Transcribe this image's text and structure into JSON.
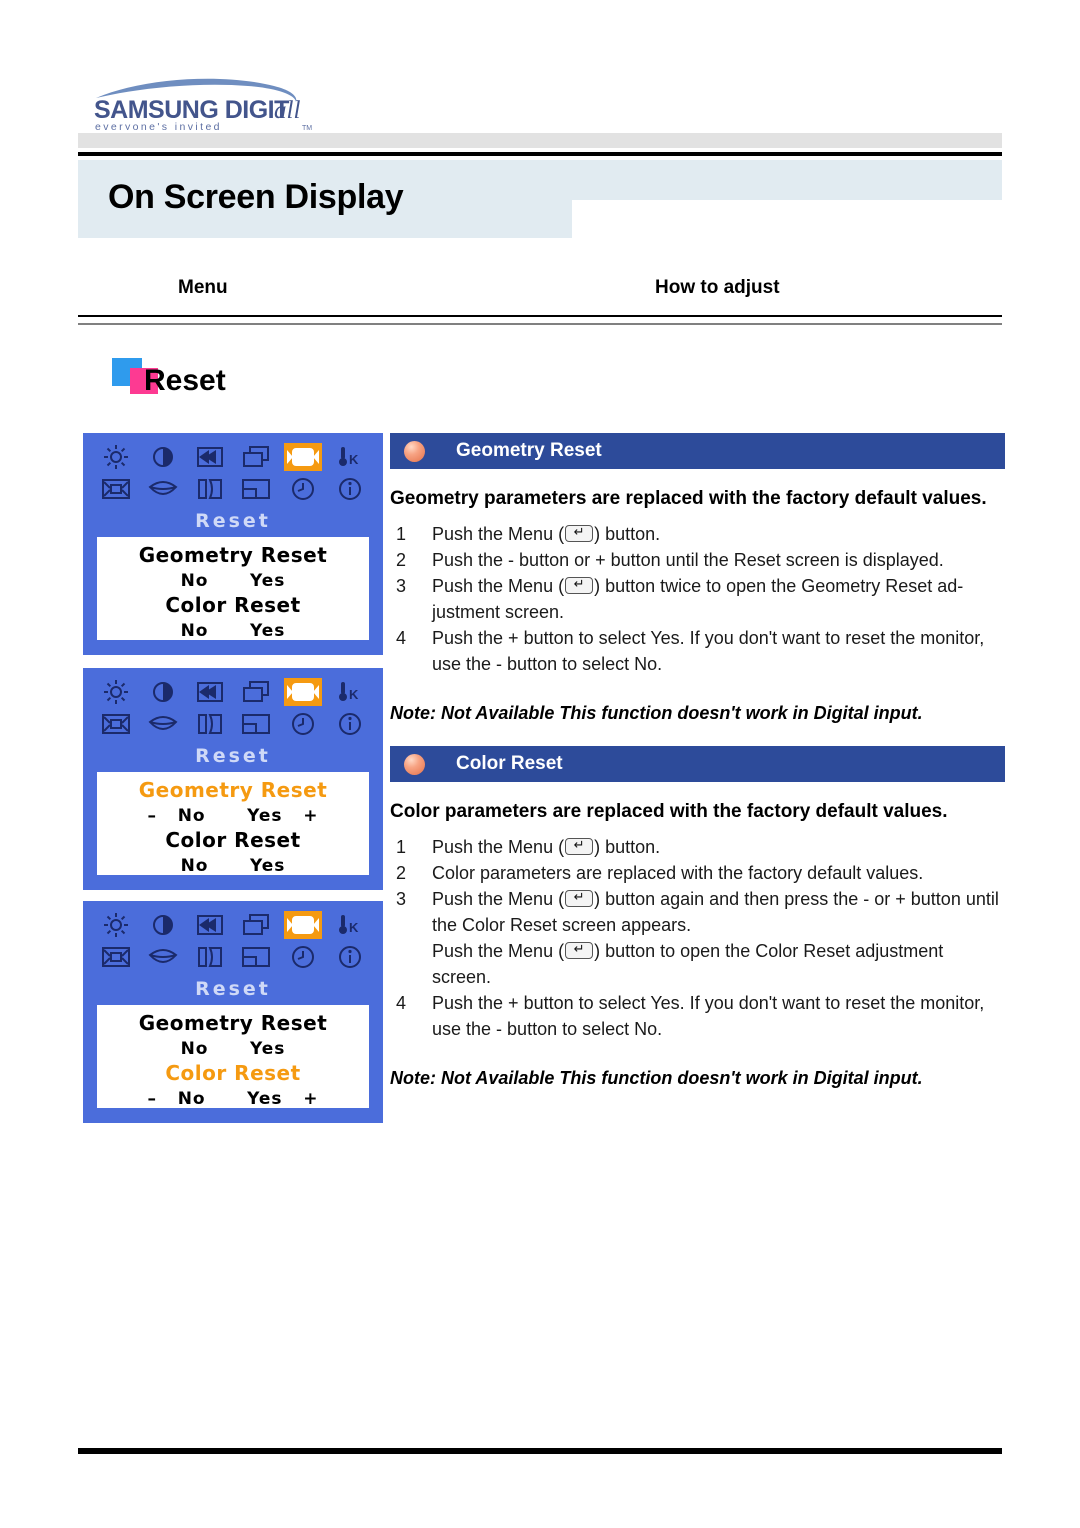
{
  "brand": {
    "wordmark_main": "SAMSUNG DIGIT",
    "wordmark_italic": "all",
    "tagline": "e v e r y o n e ' s   i n v i t e d",
    "tagline_tm": "TM"
  },
  "header": {
    "page_title": "On Screen Display",
    "column_menu": "Menu",
    "column_how": "How to adjust"
  },
  "section": {
    "title": "Reset",
    "square_blue": "#2f9bed",
    "square_pink": "#fd3a92"
  },
  "osd": {
    "background": "#4b6ddb",
    "highlight": "#f59a11",
    "label": "Reset",
    "icons": [
      {
        "name": "brightness-icon",
        "row": 1
      },
      {
        "name": "contrast-icon",
        "row": 1
      },
      {
        "name": "image-position-icon",
        "row": 1
      },
      {
        "name": "image-size-icon",
        "row": 1
      },
      {
        "name": "reset-icon",
        "row": 1,
        "selected": true
      },
      {
        "name": "color-temperature-icon",
        "row": 1
      },
      {
        "name": "zoom-icon",
        "row": 2
      },
      {
        "name": "smile-icon",
        "row": 2
      },
      {
        "name": "pincushion-icon",
        "row": 2
      },
      {
        "name": "osd-position-icon",
        "row": 2
      },
      {
        "name": "clock-icon",
        "row": 2
      },
      {
        "name": "information-icon",
        "row": 2
      }
    ],
    "panels": [
      {
        "name": "osd-panel-1",
        "rows": [
          {
            "text": "Geometry Reset",
            "highlight": false,
            "type": "title"
          },
          {
            "text": "No      Yes",
            "highlight": false,
            "type": "options"
          },
          {
            "text": "Color Reset",
            "highlight": false,
            "type": "title"
          },
          {
            "text": "No      Yes",
            "highlight": false,
            "type": "options"
          }
        ]
      },
      {
        "name": "osd-panel-2",
        "rows": [
          {
            "text": "Geometry Reset",
            "highlight": true,
            "type": "title"
          },
          {
            "text": "–   No      Yes   +",
            "highlight": false,
            "type": "options"
          },
          {
            "text": "Color Reset",
            "highlight": false,
            "type": "title"
          },
          {
            "text": "No      Yes",
            "highlight": false,
            "type": "options"
          }
        ]
      },
      {
        "name": "osd-panel-3",
        "rows": [
          {
            "text": "Geometry Reset",
            "highlight": false,
            "type": "title"
          },
          {
            "text": "No      Yes",
            "highlight": false,
            "type": "options"
          },
          {
            "text": "Color Reset",
            "highlight": true,
            "type": "title"
          },
          {
            "text": "–   No      Yes   +",
            "highlight": false,
            "type": "options"
          }
        ]
      }
    ]
  },
  "geometry_reset": {
    "bar_title": "Geometry Reset",
    "lead": "Geometry parameters are replaced with the factory default values.",
    "steps": [
      {
        "num": "1",
        "pre": "Push the Menu (",
        "post": ") button.",
        "icon": true
      },
      {
        "num": "2",
        "pre": "Push the - button or + button until the Reset screen is displayed.",
        "post": "",
        "icon": false
      },
      {
        "num": "3",
        "pre": "Push the Menu (",
        "post": ") button twice to open the Geometry Reset ad-justment screen.",
        "icon": true
      },
      {
        "num": "4",
        "pre": "Push the + button to select Yes. If you don't want to reset the monitor, use the - button to select No.",
        "post": "",
        "icon": false
      }
    ],
    "note": "Note: Not Available  This function doesn't work in Digital input."
  },
  "color_reset": {
    "bar_title": "Color Reset",
    "lead": "Color parameters are replaced with the factory default values.",
    "steps": [
      {
        "num": "1",
        "pre": "Push the Menu (",
        "post": ") button.",
        "icon": true
      },
      {
        "num": "2",
        "pre": "Color parameters are replaced with the factory default values.",
        "post": "",
        "icon": false
      },
      {
        "num": "3",
        "pre": "Push the Menu (",
        "post": ") button again and then press the - or + button until the Color Reset screen appears.",
        "icon": true
      }
    ],
    "substep": {
      "pre": "Push the Menu (",
      "post": ") button to open the Color Reset adjustment screen.",
      "icon": true
    },
    "step4": {
      "num": "4",
      "pre": "Push the + button to select Yes. If you don't want to reset the monitor, use the - button to select No.",
      "post": "",
      "icon": false
    },
    "note": "Note: Not Available  This function doesn't work in Digital input."
  }
}
